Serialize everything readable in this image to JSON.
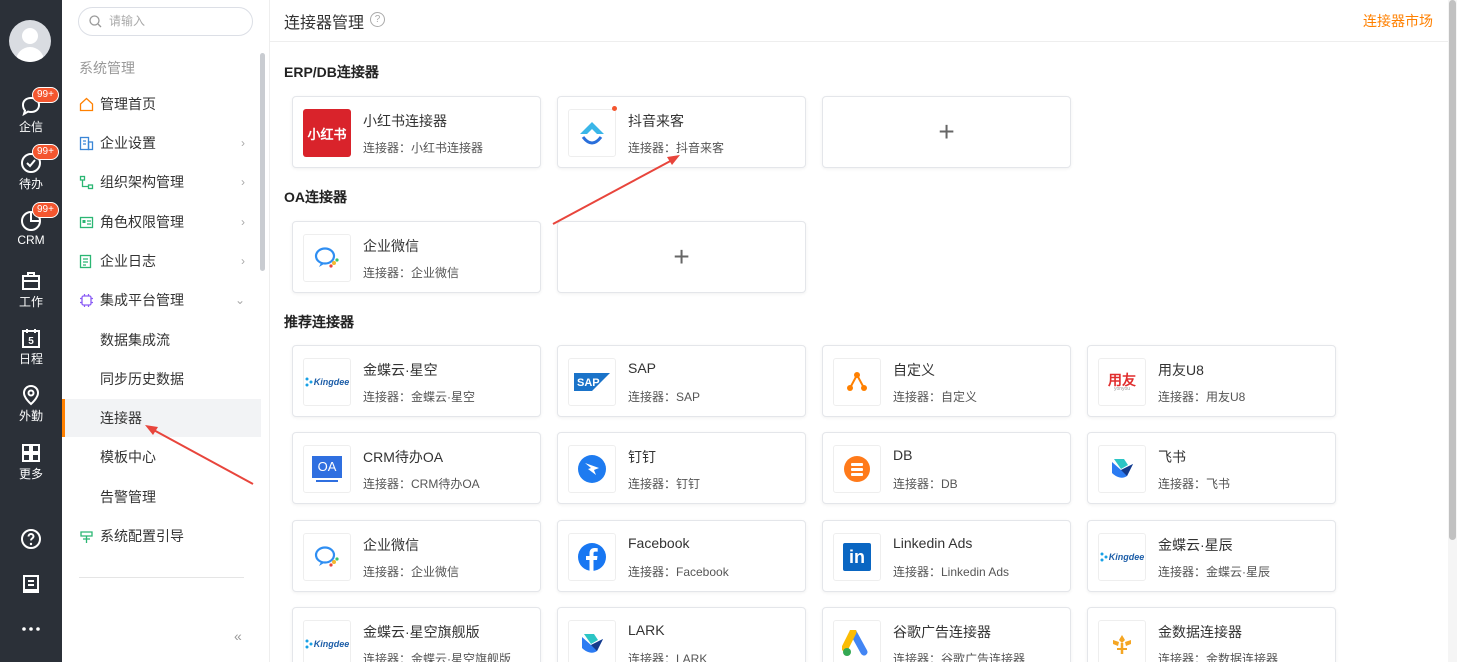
{
  "rail": {
    "items": [
      {
        "label": "企信",
        "icon": "chat-bubble-icon",
        "badge": "99+"
      },
      {
        "label": "待办",
        "icon": "check-circle-icon",
        "badge": "99+"
      },
      {
        "label": "CRM",
        "icon": "crm-chart-icon",
        "badge": "99+"
      },
      {
        "label": "工作",
        "icon": "briefcase-icon"
      },
      {
        "label": "日程",
        "icon": "calendar-icon",
        "day": "5"
      },
      {
        "label": "外勤",
        "icon": "location-pin-icon"
      },
      {
        "label": "更多",
        "icon": "grid-icon"
      }
    ]
  },
  "sidebar": {
    "search_placeholder": "请输入",
    "group_title": "系统管理",
    "items": [
      {
        "label": "管理首页"
      },
      {
        "label": "企业设置",
        "chevron": "›"
      },
      {
        "label": "组织架构管理",
        "chevron": "›"
      },
      {
        "label": "角色权限管理",
        "chevron": "›"
      },
      {
        "label": "企业日志",
        "chevron": "›"
      },
      {
        "label": "集成平台管理",
        "chevron": "⌄"
      }
    ],
    "sub_items": [
      {
        "label": "数据集成流"
      },
      {
        "label": "同步历史数据"
      },
      {
        "label": "连接器"
      },
      {
        "label": "模板中心"
      },
      {
        "label": "告警管理"
      }
    ],
    "extra_item": "系统配置引导",
    "collapse": "«"
  },
  "header": {
    "title": "连接器管理",
    "help": "?",
    "market_link": "连接器市场"
  },
  "sections": [
    {
      "title": "ERP/DB连接器"
    },
    {
      "title": "OA连接器"
    },
    {
      "title": "推荐连接器"
    }
  ],
  "add_symbol": "+",
  "cards": [
    {
      "name": "小红书连接器",
      "sub": "连接器：小红书连接器",
      "logo": "xiaohongshu-logo",
      "logo_text": "小红书"
    },
    {
      "name": "抖音来客",
      "sub": "连接器：抖音来客",
      "logo": "douyin-laike-logo"
    },
    {
      "name": "企业微信",
      "sub": "连接器：企业微信",
      "logo": "wecom-logo"
    },
    {
      "name": "金蝶云·星空",
      "sub": "连接器：金蝶云·星空",
      "logo": "kingdee-logo",
      "logo_text": "Kingdee"
    },
    {
      "name": "SAP",
      "sub": "连接器：SAP",
      "logo": "sap-logo",
      "logo_text": "SAP"
    },
    {
      "name": "自定义",
      "sub": "连接器：自定义",
      "logo": "custom-logo"
    },
    {
      "name": "用友U8",
      "sub": "连接器：用友U8",
      "logo": "yonyou-logo",
      "logo_text": "用友"
    },
    {
      "name": "CRM待办OA",
      "sub": "连接器：CRM待办OA",
      "logo": "oa-logo",
      "logo_text": "OA"
    },
    {
      "name": "钉钉",
      "sub": "连接器：钉钉",
      "logo": "dingtalk-logo"
    },
    {
      "name": "DB",
      "sub": "连接器：DB",
      "logo": "db-logo"
    },
    {
      "name": "飞书",
      "sub": "连接器：飞书",
      "logo": "feishu-logo"
    },
    {
      "name": "企业微信",
      "sub": "连接器：企业微信",
      "logo": "wecom-logo"
    },
    {
      "name": "Facebook",
      "sub": "连接器：Facebook",
      "logo": "facebook-logo"
    },
    {
      "name": "Linkedin Ads",
      "sub": "连接器：Linkedin Ads",
      "logo": "linkedin-logo",
      "logo_text": "in"
    },
    {
      "name": "金蝶云·星辰",
      "sub": "连接器：金蝶云·星辰",
      "logo": "kingdee-logo",
      "logo_text": "Kingdee"
    },
    {
      "name": "金蝶云·星空旗舰版",
      "sub": "连接器：金蝶云·星空旗舰版",
      "logo": "kingdee-logo",
      "logo_text": "Kingdee"
    },
    {
      "name": "LARK",
      "sub": "连接器：LARK",
      "logo": "lark-logo"
    },
    {
      "name": "谷歌广告连接器",
      "sub": "连接器：谷歌广告连接器",
      "logo": "google-ads-logo"
    },
    {
      "name": "金数据连接器",
      "sub": "连接器：金数据连接器",
      "logo": "jinshuju-logo"
    }
  ],
  "colors": {
    "accent": "#ff8000",
    "rail_bg": "#2b3038",
    "badge": "#f4562f",
    "annotation_arrow": "#e8453c"
  }
}
